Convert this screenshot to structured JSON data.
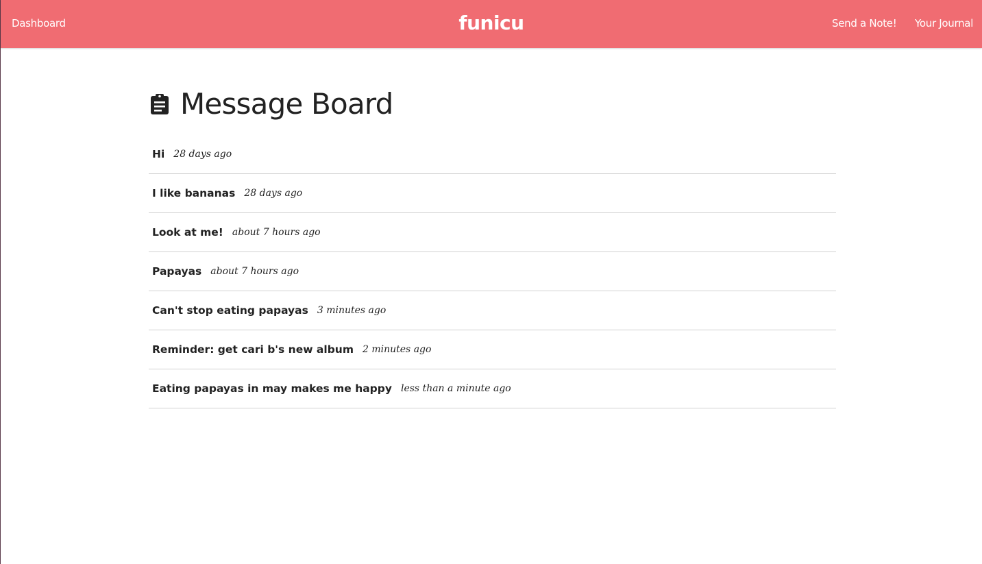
{
  "navbar": {
    "background_color": "#f06c72",
    "left_link": "Dashboard",
    "brand": "funicu",
    "right_links": [
      "Send a Note!",
      "Your Journal"
    ]
  },
  "main": {
    "icon": "clipboard-icon",
    "title": "Message Board",
    "messages": [
      {
        "title": "Hi",
        "time": "28 days ago"
      },
      {
        "title": "I like bananas",
        "time": "28 days ago"
      },
      {
        "title": "Look at me!",
        "time": "about 7 hours ago"
      },
      {
        "title": "Papayas",
        "time": "about 7 hours ago"
      },
      {
        "title": "Can't stop eating papayas",
        "time": "3 minutes ago"
      },
      {
        "title": "Reminder: get cari b's new album",
        "time": "2 minutes ago"
      },
      {
        "title": "Eating papayas in may makes me happy",
        "time": "less than a minute ago"
      }
    ]
  }
}
